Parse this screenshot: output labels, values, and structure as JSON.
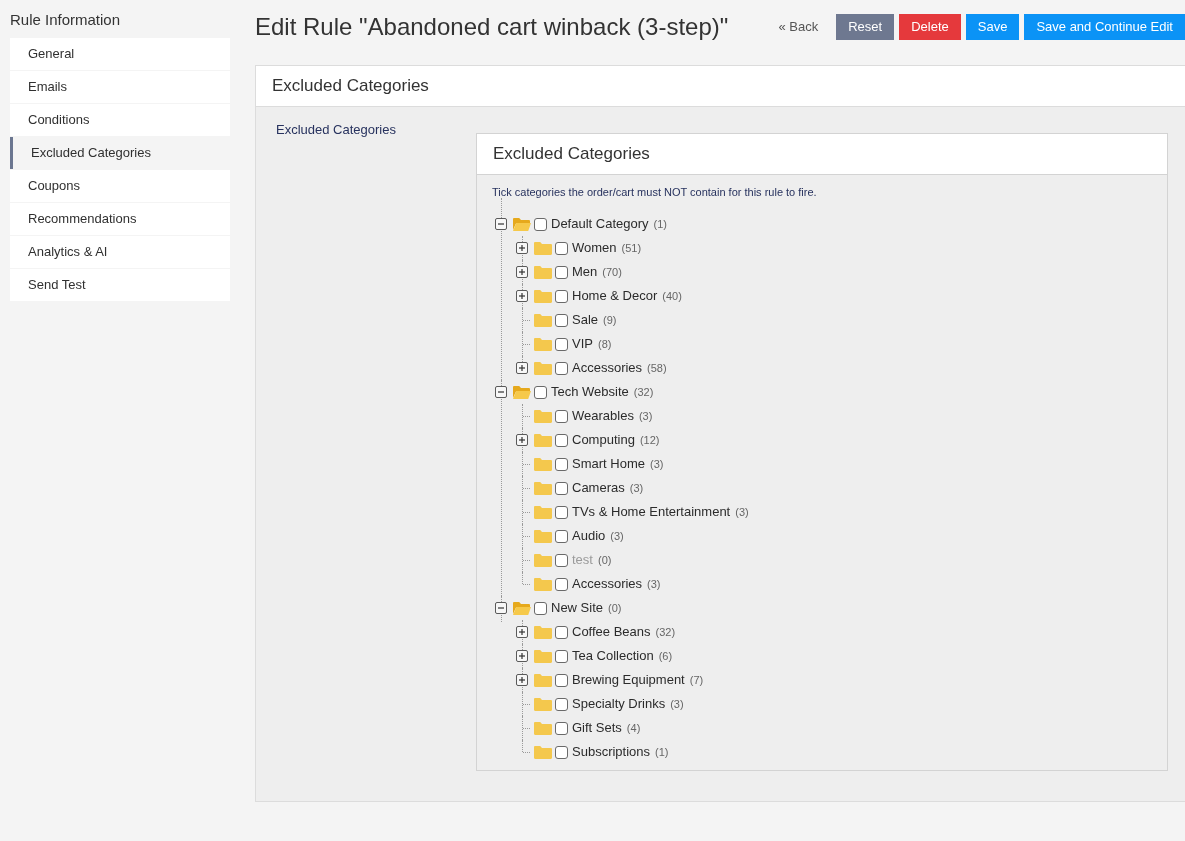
{
  "sidebar": {
    "title": "Rule Information",
    "items": [
      {
        "label": "General",
        "selected": false
      },
      {
        "label": "Emails",
        "selected": false
      },
      {
        "label": "Conditions",
        "selected": false
      },
      {
        "label": "Excluded Categories",
        "selected": true
      },
      {
        "label": "Coupons",
        "selected": false
      },
      {
        "label": "Recommendations",
        "selected": false
      },
      {
        "label": "Analytics & AI",
        "selected": false
      },
      {
        "label": "Send Test",
        "selected": false
      }
    ]
  },
  "header": {
    "title": "Edit Rule \"Abandoned cart winback (3-step)\"",
    "back_link": "« Back",
    "buttons": [
      {
        "label": "Reset",
        "kind": "reset"
      },
      {
        "label": "Delete",
        "kind": "delete"
      },
      {
        "label": "Save",
        "kind": "save"
      },
      {
        "label": "Save and Continue Edit",
        "kind": "save-continue"
      }
    ]
  },
  "panel": {
    "title": "Excluded Categories",
    "field_label": "Excluded Categories",
    "tree_card": {
      "title": "Excluded Categories",
      "hint": "Tick categories the order/cart must NOT contain for this rule to fire.",
      "tree": [
        {
          "kind": "branch",
          "label": "Default Category",
          "count": "(1)",
          "expanded": true,
          "checked": false,
          "disabled": false,
          "children": [
            {
              "kind": "branch",
              "label": "Women",
              "count": "(51)",
              "expanded": false,
              "checked": false,
              "disabled": false
            },
            {
              "kind": "branch",
              "label": "Men",
              "count": "(70)",
              "expanded": false,
              "checked": false,
              "disabled": false
            },
            {
              "kind": "branch",
              "label": "Home & Decor",
              "count": "(40)",
              "expanded": false,
              "checked": false,
              "disabled": false
            },
            {
              "kind": "leaf",
              "label": "Sale",
              "count": "(9)",
              "checked": false,
              "disabled": false
            },
            {
              "kind": "leaf",
              "label": "VIP",
              "count": "(8)",
              "checked": false,
              "disabled": false
            },
            {
              "kind": "branch",
              "label": "Accessories",
              "count": "(58)",
              "expanded": false,
              "checked": false,
              "disabled": false
            }
          ]
        },
        {
          "kind": "branch",
          "label": "Tech Website",
          "count": "(32)",
          "expanded": true,
          "checked": false,
          "disabled": false,
          "children": [
            {
              "kind": "leaf",
              "label": "Wearables",
              "count": "(3)",
              "checked": false,
              "disabled": false
            },
            {
              "kind": "branch",
              "label": "Computing",
              "count": "(12)",
              "expanded": false,
              "checked": false,
              "disabled": false
            },
            {
              "kind": "leaf",
              "label": "Smart Home",
              "count": "(3)",
              "checked": false,
              "disabled": false
            },
            {
              "kind": "leaf",
              "label": "Cameras",
              "count": "(3)",
              "checked": false,
              "disabled": false
            },
            {
              "kind": "leaf",
              "label": "TVs & Home Entertainment",
              "count": "(3)",
              "checked": false,
              "disabled": false
            },
            {
              "kind": "leaf",
              "label": "Audio",
              "count": "(3)",
              "checked": false,
              "disabled": false
            },
            {
              "kind": "leaf",
              "label": "test",
              "count": "(0)",
              "checked": false,
              "disabled": true
            },
            {
              "kind": "leaf",
              "label": "Accessories",
              "count": "(3)",
              "checked": false,
              "disabled": false
            }
          ]
        },
        {
          "kind": "branch",
          "label": "New Site",
          "count": "(0)",
          "expanded": true,
          "checked": false,
          "disabled": false,
          "children": [
            {
              "kind": "branch",
              "label": "Coffee Beans",
              "count": "(32)",
              "expanded": false,
              "checked": false,
              "disabled": false
            },
            {
              "kind": "branch",
              "label": "Tea Collection",
              "count": "(6)",
              "expanded": false,
              "checked": false,
              "disabled": false
            },
            {
              "kind": "branch",
              "label": "Brewing Equipment",
              "count": "(7)",
              "expanded": false,
              "checked": false,
              "disabled": false
            },
            {
              "kind": "leaf",
              "label": "Specialty Drinks",
              "count": "(3)",
              "checked": false,
              "disabled": false
            },
            {
              "kind": "leaf",
              "label": "Gift Sets",
              "count": "(4)",
              "checked": false,
              "disabled": false
            },
            {
              "kind": "leaf",
              "label": "Subscriptions",
              "count": "(1)",
              "checked": false,
              "disabled": false
            }
          ]
        }
      ]
    }
  }
}
